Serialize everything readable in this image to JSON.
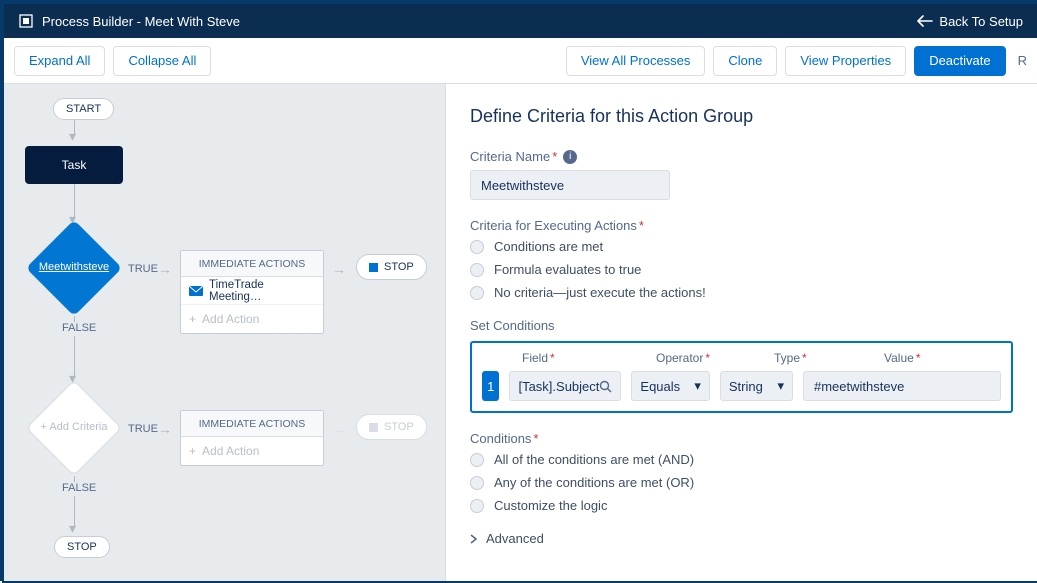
{
  "header": {
    "title": "Process Builder - Meet With Steve",
    "back": "Back To Setup"
  },
  "toolbar": {
    "expand": "Expand All",
    "collapse": "Collapse All",
    "viewAll": "View All Processes",
    "clone": "Clone",
    "viewProps": "View Properties",
    "deactivate": "Deactivate",
    "trailing": "R"
  },
  "canvas": {
    "start": "START",
    "task": "Task",
    "diamond1": "Meetwithsteve",
    "diamond2": "Add Criteria",
    "true": "TRUE",
    "false": "FALSE",
    "immHd": "IMMEDIATE ACTIONS",
    "action1": "TimeTrade Meeting…",
    "addAction": "Add Action",
    "stop": "STOP"
  },
  "panel": {
    "title": "Define Criteria for this Action Group",
    "critNameLbl": "Criteria Name",
    "critName": "Meetwithsteve",
    "execLbl": "Criteria for Executing Actions",
    "execOpts": [
      "Conditions are met",
      "Formula evaluates to true",
      "No criteria—just execute the actions!"
    ],
    "setCond": "Set Conditions",
    "cols": {
      "field": "Field",
      "operator": "Operator",
      "type": "Type",
      "value": "Value"
    },
    "row": {
      "idx": "1",
      "field": "[Task].Subject",
      "operator": "Equals",
      "type": "String",
      "value": "#meetwithsteve"
    },
    "condsLbl": "Conditions",
    "condsOpts": [
      "All of the conditions are met (AND)",
      "Any of the conditions are met (OR)",
      "Customize the logic"
    ],
    "advanced": "Advanced"
  }
}
